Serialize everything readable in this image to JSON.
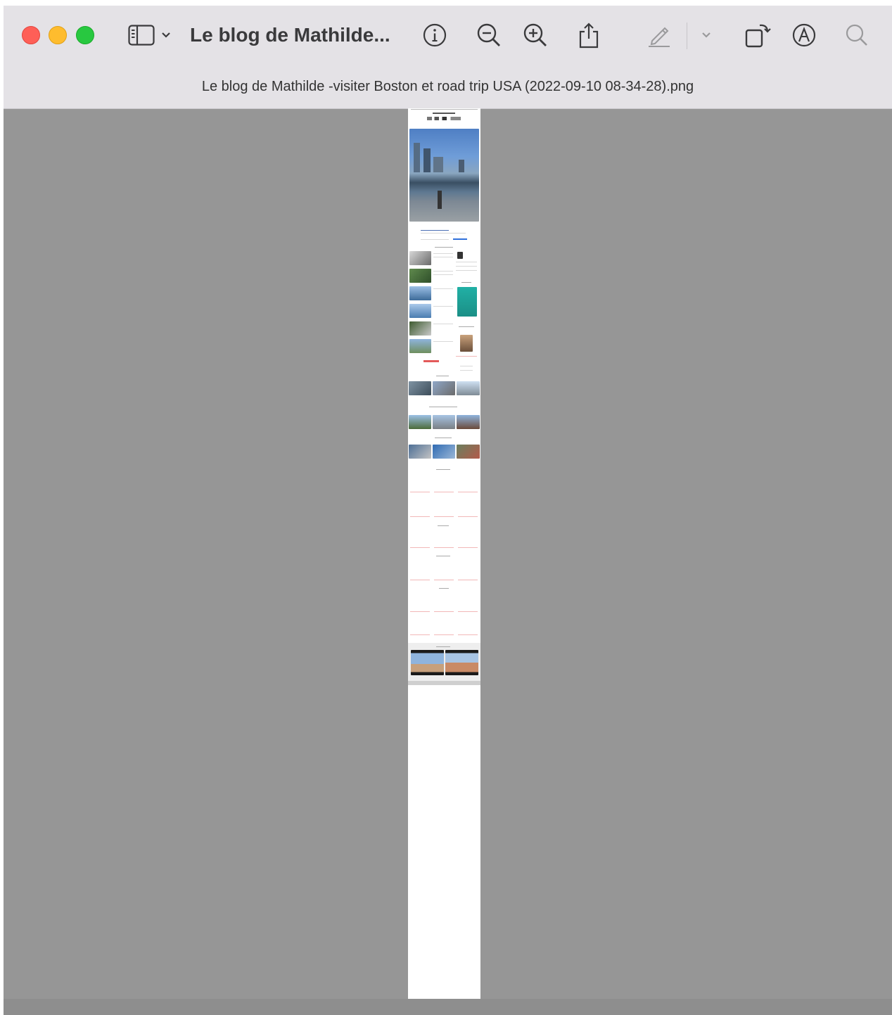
{
  "window": {
    "title": "Le blog de Mathilde...",
    "file_name": "Le blog de Mathilde -visiter Boston et road trip USA (2022-09-10 08-34-28).png"
  },
  "toolbar": {
    "icons": [
      "sidebar-icon",
      "chevron-down-icon",
      "info-icon",
      "zoom-out-icon",
      "zoom-in-icon",
      "share-icon",
      "markup-pen-icon",
      "chevron-down-icon",
      "rotate-icon",
      "annotate-icon",
      "search-icon"
    ]
  },
  "colors": {
    "titlebar": "#e4e2e6",
    "canvas": "#969696",
    "close": "#fe5f57",
    "minimize": "#febc2e",
    "maximize": "#28c840"
  }
}
